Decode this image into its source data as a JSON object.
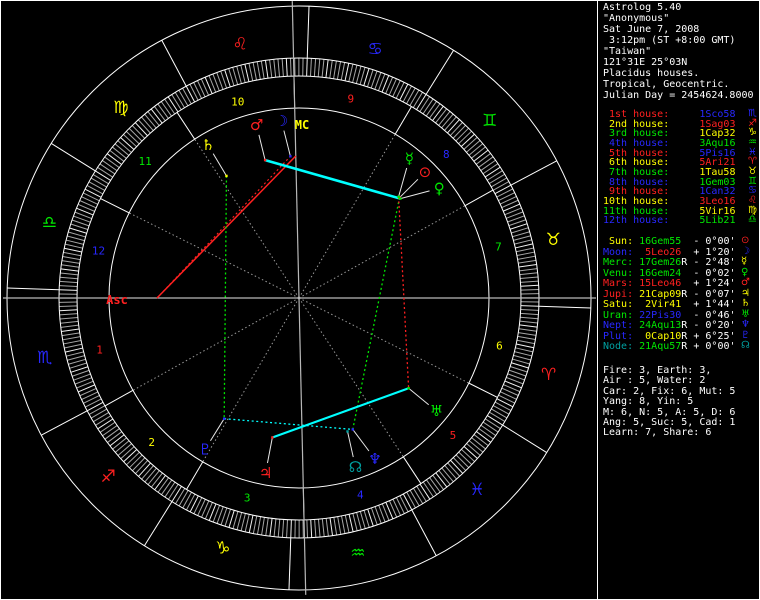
{
  "app": {
    "name": "Astrolog 5.40"
  },
  "colors": {
    "red": "#ff2020",
    "yellow": "#ffff00",
    "green": "#00e800",
    "blue": "#2828ff",
    "cyan": "#00ffff",
    "dkcyan": "#00a0a0",
    "white": "#ffffff",
    "gray_dotted": "#989898",
    "axis_gray": "#b8b8b8",
    "ring_white": "#ffffff",
    "background": "#000000"
  },
  "panel": {
    "title_lines": [
      "Astrolog 5.40",
      "\"Anonymous\"",
      "Sat June 7, 2008",
      " 3:12pm (ST +8:00 GMT)",
      "\"Taiwan\"",
      "121°31E 25°03N",
      "Placidus houses.",
      "Tropical, Geocentric.",
      "Julian Day = 2454624.8000"
    ],
    "houses": [
      {
        "label": " 1st house:",
        "lc": "red",
        "value": "1Sco58",
        "vc": "blue",
        "glyph": "♏"
      },
      {
        "label": " 2nd house:",
        "lc": "yellow",
        "value": "1Sag03",
        "vc": "red",
        "glyph": "♐"
      },
      {
        "label": " 3rd house:",
        "lc": "green",
        "value": "1Cap32",
        "vc": "yellow",
        "glyph": "♑"
      },
      {
        "label": " 4th house:",
        "lc": "blue",
        "value": "3Aqu16",
        "vc": "green",
        "glyph": "♒"
      },
      {
        "label": " 5th house:",
        "lc": "red",
        "value": "5Pis16",
        "vc": "blue",
        "glyph": "♓"
      },
      {
        "label": " 6th house:",
        "lc": "yellow",
        "value": "5Ari21",
        "vc": "red",
        "glyph": "♈"
      },
      {
        "label": " 7th house:",
        "lc": "green",
        "value": "1Tau58",
        "vc": "yellow",
        "glyph": "♉"
      },
      {
        "label": " 8th house:",
        "lc": "blue",
        "value": "1Gem03",
        "vc": "green",
        "glyph": "♊"
      },
      {
        "label": " 9th house:",
        "lc": "red",
        "value": "1Can32",
        "vc": "blue",
        "glyph": "♋"
      },
      {
        "label": "10th house:",
        "lc": "yellow",
        "value": "3Leo16",
        "vc": "red",
        "glyph": "♌"
      },
      {
        "label": "11th house:",
        "lc": "green",
        "value": "5Vir16",
        "vc": "yellow",
        "glyph": "♍"
      },
      {
        "label": "12th house:",
        "lc": "blue",
        "value": "5Lib21",
        "vc": "green",
        "glyph": "♎"
      }
    ],
    "planets": [
      {
        "label": " Sun:",
        "lc": "yellow",
        "value": "16Gem55",
        "retro": " ",
        "vc": "green",
        "offset": "- 0°00'",
        "glyph": "⊙",
        "gc": "red"
      },
      {
        "label": "Moon:",
        "lc": "blue",
        "value": " 5Leo26",
        "retro": " ",
        "vc": "red",
        "offset": "+ 1°20'",
        "glyph": "☽",
        "gc": "blue"
      },
      {
        "label": "Merc:",
        "lc": "green",
        "value": "17Gem26",
        "retro": "R",
        "vc": "green",
        "offset": "- 2°48'",
        "glyph": "☿",
        "gc": "yellow"
      },
      {
        "label": "Venu:",
        "lc": "green",
        "value": "16Gem24",
        "retro": " ",
        "vc": "green",
        "offset": "- 0°02'",
        "glyph": "♀",
        "gc": "green"
      },
      {
        "label": "Mars:",
        "lc": "red",
        "value": "15Leo46",
        "retro": " ",
        "vc": "red",
        "offset": "+ 1°24'",
        "glyph": "♂",
        "gc": "red"
      },
      {
        "label": "Jupi:",
        "lc": "red",
        "value": "21Cap09",
        "retro": "R",
        "vc": "yellow",
        "offset": "- 0°07'",
        "glyph": "♃",
        "gc": "yellow"
      },
      {
        "label": "Satu:",
        "lc": "yellow",
        "value": " 2Vir41",
        "retro": " ",
        "vc": "yellow",
        "offset": "+ 1°44'",
        "glyph": "♄",
        "gc": "yellow"
      },
      {
        "label": "Uran:",
        "lc": "green",
        "value": "22Pis30",
        "retro": " ",
        "vc": "blue",
        "offset": "- 0°46'",
        "glyph": "♅",
        "gc": "green"
      },
      {
        "label": "Nept:",
        "lc": "blue",
        "value": "24Aqu13",
        "retro": "R",
        "vc": "green",
        "offset": "- 0°20'",
        "glyph": "♆",
        "gc": "blue"
      },
      {
        "label": "Plut:",
        "lc": "blue",
        "value": " 0Cap10",
        "retro": "R",
        "vc": "yellow",
        "offset": "+ 6°25'",
        "glyph": "♇",
        "gc": "blue"
      },
      {
        "label": "Node:",
        "lc": "dkcyan",
        "value": "21Aqu57",
        "retro": "R",
        "vc": "green",
        "offset": "+ 0°00'",
        "glyph": "☊",
        "gc": "dkcyan"
      }
    ],
    "stats_lines": [
      "Fire: 3, Earth: 3,",
      "Air : 5, Water: 2",
      "Car: 2, Fix: 6, Mut: 5",
      "Yang: 8, Yin: 5",
      "M: 6, N: 5, A: 5, D: 6",
      "Ang: 5, Suc: 5, Cad: 1",
      "Learn: 7, Share: 6"
    ]
  },
  "chart_data": {
    "type": "astrology-natal-wheel",
    "ascendant_lon": 211.967,
    "mc_lon": 123.267,
    "house_cusps_lon": [
      211.967,
      241.05,
      271.533,
      303.267,
      335.267,
      5.35,
      31.967,
      61.05,
      91.533,
      123.267,
      155.267,
      185.35
    ],
    "house_number_colors": [
      "red",
      "yellow",
      "green",
      "blue",
      "red",
      "yellow",
      "green",
      "blue",
      "red",
      "yellow",
      "green",
      "blue"
    ],
    "signs": [
      {
        "name": "Aries",
        "glyph": "♈",
        "color": "red"
      },
      {
        "name": "Taurus",
        "glyph": "♉",
        "color": "yellow"
      },
      {
        "name": "Gemini",
        "glyph": "♊",
        "color": "green"
      },
      {
        "name": "Cancer",
        "glyph": "♋",
        "color": "blue"
      },
      {
        "name": "Leo",
        "glyph": "♌",
        "color": "red"
      },
      {
        "name": "Virgo",
        "glyph": "♍",
        "color": "yellow"
      },
      {
        "name": "Libra",
        "glyph": "♎",
        "color": "green"
      },
      {
        "name": "Scorpio",
        "glyph": "♏",
        "color": "blue"
      },
      {
        "name": "Sagittarius",
        "glyph": "♐",
        "color": "red"
      },
      {
        "name": "Capricorn",
        "glyph": "♑",
        "color": "yellow"
      },
      {
        "name": "Aquarius",
        "glyph": "♒",
        "color": "green"
      },
      {
        "name": "Pisces",
        "glyph": "♓",
        "color": "blue"
      }
    ],
    "planets": [
      {
        "name": "Sun",
        "glyph": "⊙",
        "lon": 76.917,
        "color": "red"
      },
      {
        "name": "Moon",
        "glyph": "☽",
        "lon": 125.433,
        "color": "blue"
      },
      {
        "name": "Mercury",
        "glyph": "☿",
        "lon": 77.433,
        "color": "green"
      },
      {
        "name": "Venus",
        "glyph": "♀",
        "lon": 76.4,
        "color": "green"
      },
      {
        "name": "Mars",
        "glyph": "♂",
        "lon": 135.767,
        "color": "red"
      },
      {
        "name": "Jupiter",
        "glyph": "♃",
        "lon": 291.15,
        "color": "red"
      },
      {
        "name": "Saturn",
        "glyph": "♄",
        "lon": 152.683,
        "color": "yellow"
      },
      {
        "name": "Uranus",
        "glyph": "♅",
        "lon": 352.5,
        "color": "green"
      },
      {
        "name": "Neptune",
        "glyph": "♆",
        "lon": 324.217,
        "color": "blue"
      },
      {
        "name": "Pluto",
        "glyph": "♇",
        "lon": 270.167,
        "color": "blue"
      },
      {
        "name": "Node",
        "glyph": "☊",
        "lon": 321.95,
        "color": "dkcyan"
      }
    ],
    "angle_labels": [
      {
        "name": "MC",
        "text": "MC",
        "lon": 123.267,
        "color": "yellow"
      },
      {
        "name": "Asc",
        "text": "Asc",
        "lon": 211.967,
        "color": "red"
      }
    ],
    "aspect_lines": [
      {
        "a": "Asc",
        "b": "MC",
        "aspect": "square",
        "color": "red",
        "style": "solid",
        "w": 1.5
      },
      {
        "a": "Asc",
        "b": "Moon",
        "aspect": "square",
        "color": "red",
        "style": "dotted",
        "w": 1.1
      },
      {
        "a": "Mars",
        "b": "Venus",
        "aspect": "sextile",
        "color": "cyan",
        "style": "solid",
        "w": 2.6
      },
      {
        "a": "Saturn",
        "b": "Pluto",
        "aspect": "trine",
        "color": "green",
        "style": "dotted",
        "w": 1.3
      },
      {
        "a": "Sun",
        "b": "Neptune",
        "aspect": "trine",
        "color": "green",
        "style": "dotted",
        "w": 1.3
      },
      {
        "a": "Mercury",
        "b": "Uranus",
        "aspect": "square",
        "color": "red",
        "style": "dotted",
        "w": 1.3
      },
      {
        "a": "Jupiter",
        "b": "Uranus",
        "aspect": "sextile",
        "color": "cyan",
        "style": "solid",
        "w": 2.2
      },
      {
        "a": "Pluto",
        "b": "Neptune",
        "aspect": "sextile",
        "color": "cyan",
        "style": "dotted",
        "w": 1.3
      }
    ]
  }
}
